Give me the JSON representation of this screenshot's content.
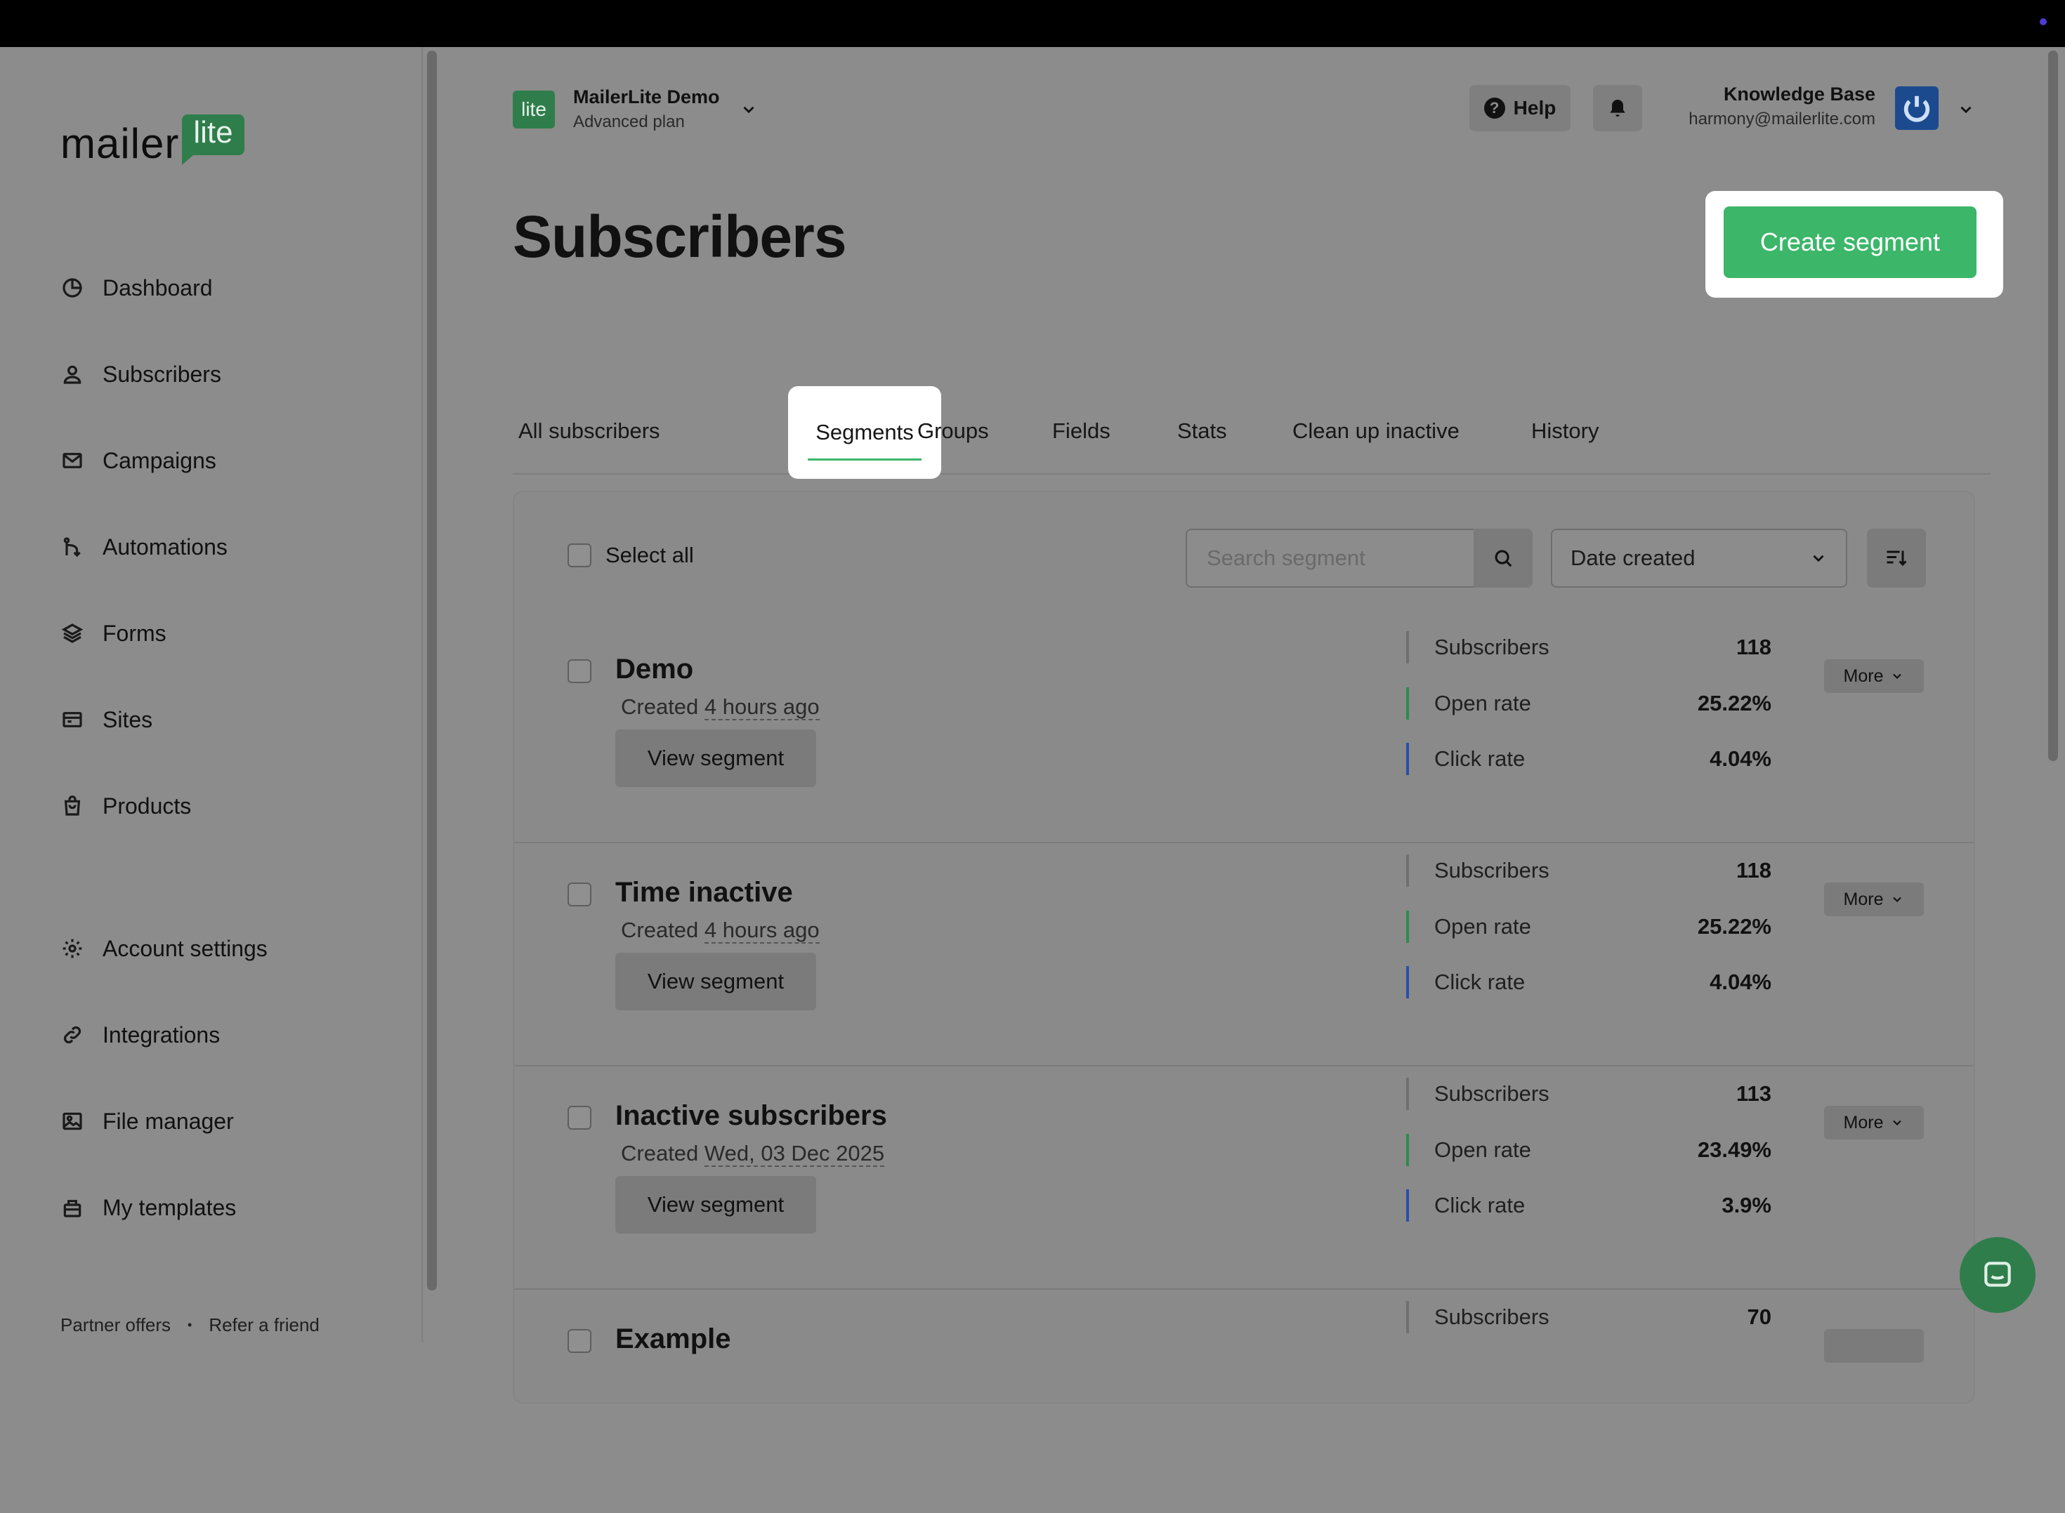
{
  "brand": {
    "word": "mailer",
    "lite": "lite"
  },
  "sidebar": {
    "items": [
      {
        "label": "Dashboard",
        "icon": "dashboard-icon"
      },
      {
        "label": "Subscribers",
        "icon": "user-icon"
      },
      {
        "label": "Campaigns",
        "icon": "envelope-icon"
      },
      {
        "label": "Automations",
        "icon": "automation-icon"
      },
      {
        "label": "Forms",
        "icon": "layers-icon"
      },
      {
        "label": "Sites",
        "icon": "browser-icon"
      },
      {
        "label": "Products",
        "icon": "bag-icon"
      },
      {
        "label": "Account settings",
        "icon": "gear-icon"
      },
      {
        "label": "Integrations",
        "icon": "link-icon"
      },
      {
        "label": "File manager",
        "icon": "image-icon"
      },
      {
        "label": "My templates",
        "icon": "template-icon"
      }
    ],
    "footer": {
      "partner": "Partner offers",
      "refer": "Refer a friend",
      "separator": "•"
    }
  },
  "header": {
    "account_badge": "lite",
    "account_name": "MailerLite Demo",
    "account_plan": "Advanced plan",
    "help_label": "Help",
    "user_name": "Knowledge Base",
    "user_email": "harmony@mailerlite.com"
  },
  "page": {
    "title": "Subscribers",
    "create_button": "Create segment",
    "tabs": [
      "All subscribers",
      "Segments",
      "Groups",
      "Fields",
      "Stats",
      "Clean up inactive",
      "History"
    ],
    "active_tab": "Segments"
  },
  "toolbar": {
    "select_all": "Select all",
    "search_placeholder": "Search segment",
    "sort_value": "Date created"
  },
  "segments": [
    {
      "name": "Demo",
      "created_prefix": "Created",
      "created": "4 hours ago",
      "view": "View segment",
      "more": "More",
      "stats": [
        {
          "label": "Subscribers",
          "value": "118"
        },
        {
          "label": "Open rate",
          "value": "25.22%"
        },
        {
          "label": "Click rate",
          "value": "4.04%"
        }
      ]
    },
    {
      "name": "Time inactive",
      "created_prefix": "Created",
      "created": "4 hours ago",
      "view": "View segment",
      "more": "More",
      "stats": [
        {
          "label": "Subscribers",
          "value": "118"
        },
        {
          "label": "Open rate",
          "value": "25.22%"
        },
        {
          "label": "Click rate",
          "value": "4.04%"
        }
      ]
    },
    {
      "name": "Inactive subscribers",
      "created_prefix": "Created",
      "created": "Wed, 03 Dec 2025",
      "view": "View segment",
      "more": "More",
      "stats": [
        {
          "label": "Subscribers",
          "value": "113"
        },
        {
          "label": "Open rate",
          "value": "23.49%"
        },
        {
          "label": "Click rate",
          "value": "3.9%"
        }
      ]
    },
    {
      "name": "Example",
      "created_prefix": "",
      "created": "",
      "view": "",
      "more": "",
      "stats": [
        {
          "label": "Subscribers",
          "value": "70"
        }
      ]
    }
  ],
  "colors": {
    "accent_green": "#3cb669",
    "brand_green": "#2f7d4b",
    "bar_subscribers": "#707070",
    "bar_open": "#2f8a4f",
    "bar_click": "#2b4fa8"
  }
}
